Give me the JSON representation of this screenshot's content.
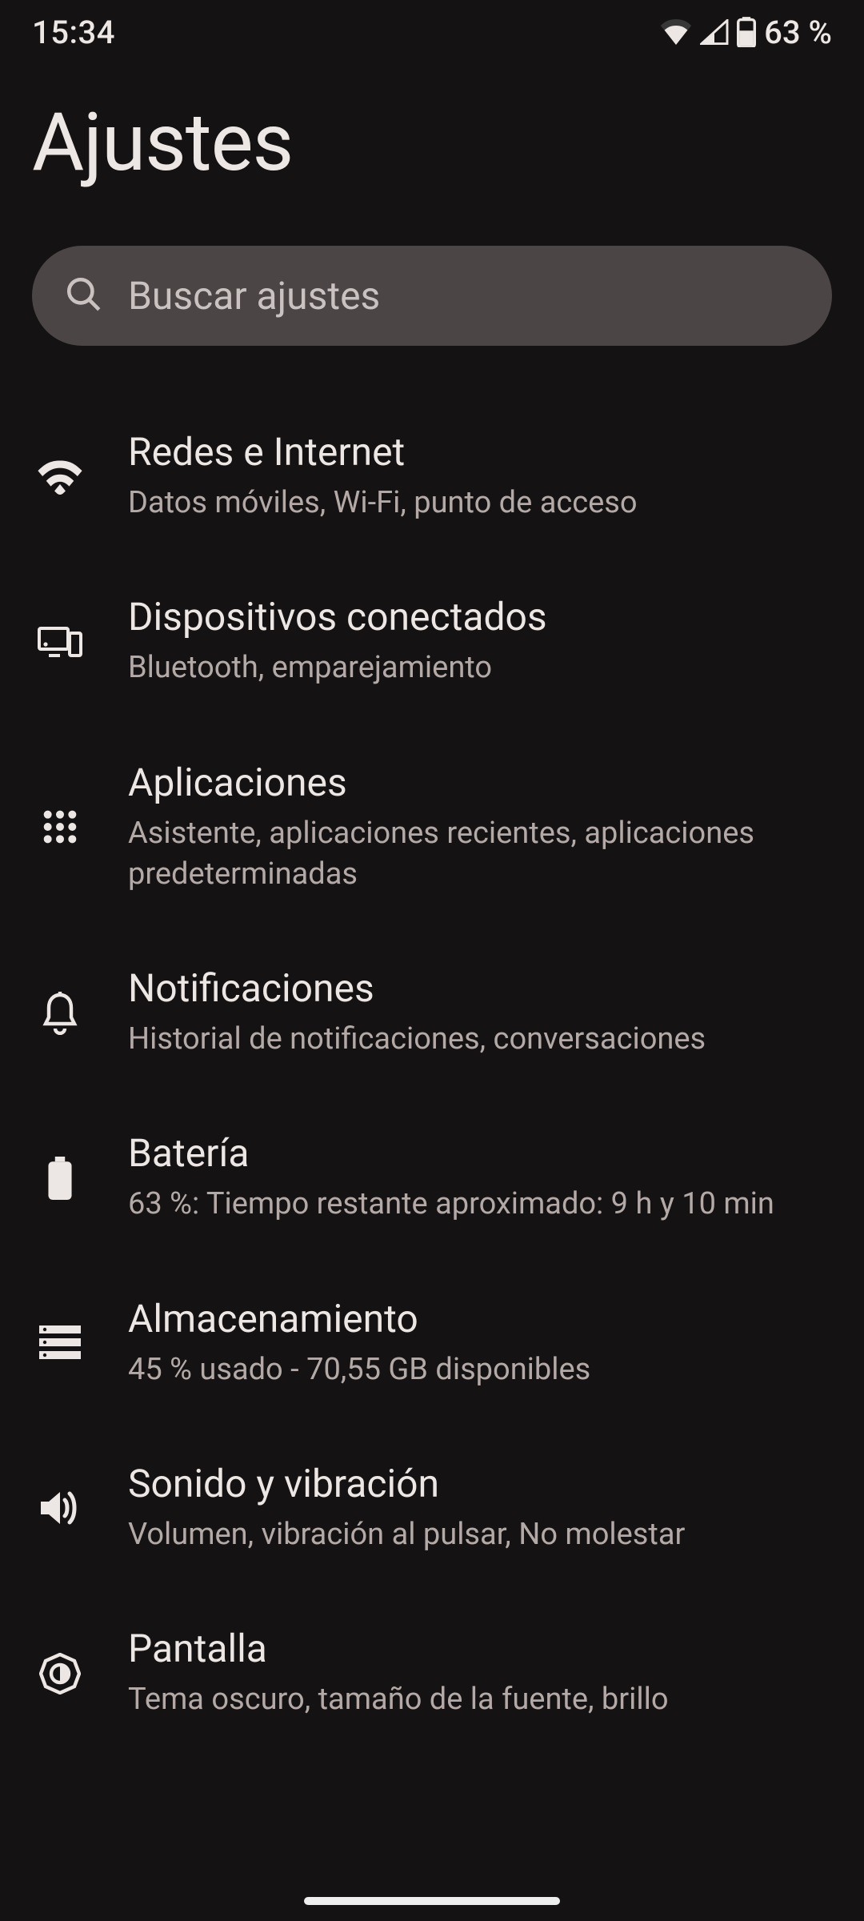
{
  "status": {
    "time": "15:34",
    "battery_text": "63 %"
  },
  "page": {
    "title": "Ajustes"
  },
  "search": {
    "placeholder": "Buscar ajustes"
  },
  "items": [
    {
      "title": "Redes e Internet",
      "subtitle": "Datos móviles, Wi-Fi, punto de acceso",
      "icon": "wifi-icon"
    },
    {
      "title": "Dispositivos conectados",
      "subtitle": "Bluetooth, emparejamiento",
      "icon": "devices-icon"
    },
    {
      "title": "Aplicaciones",
      "subtitle": "Asistente, aplicaciones recientes, aplicaciones predeterminadas",
      "icon": "apps-icon"
    },
    {
      "title": "Notificaciones",
      "subtitle": "Historial de notificaciones, conversaciones",
      "icon": "bell-icon"
    },
    {
      "title": "Batería",
      "subtitle": "63 %: Tiempo restante aproximado: 9 h y 10 min",
      "icon": "battery-icon"
    },
    {
      "title": "Almacenamiento",
      "subtitle": "45 % usado - 70,55 GB disponibles",
      "icon": "storage-icon"
    },
    {
      "title": "Sonido y vibración",
      "subtitle": "Volumen, vibración al pulsar, No molestar",
      "icon": "volume-icon"
    },
    {
      "title": "Pantalla",
      "subtitle": "Tema oscuro, tamaño de la fuente, brillo",
      "icon": "brightness-icon"
    }
  ]
}
